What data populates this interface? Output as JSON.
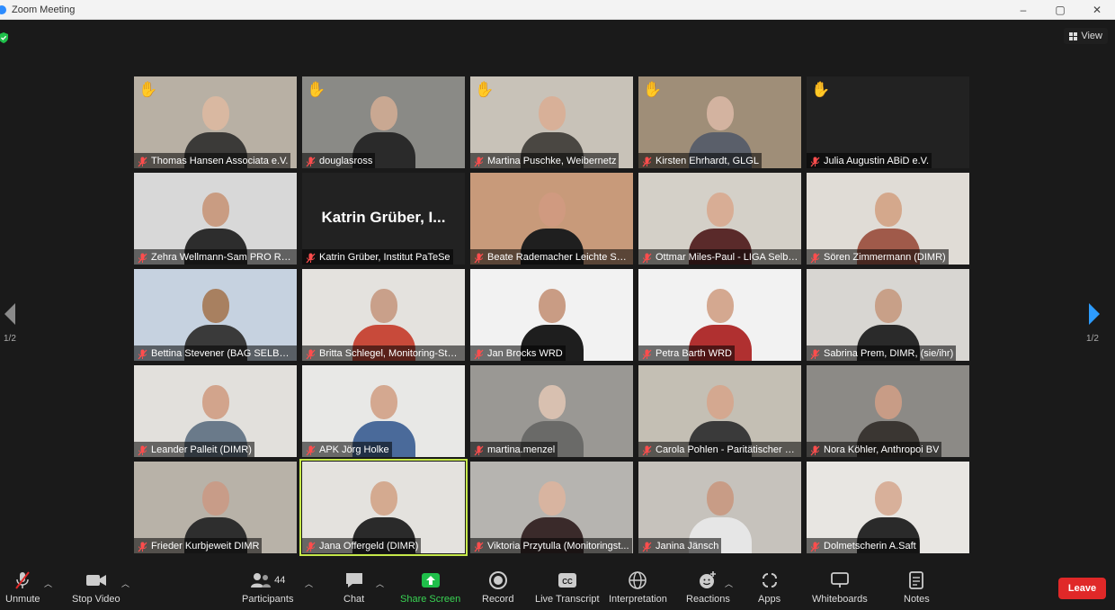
{
  "window": {
    "title": "Zoom Meeting",
    "controls": [
      "–",
      "▢",
      "✕"
    ]
  },
  "view_button": {
    "label": "View"
  },
  "pagination": {
    "left_label": "1/2",
    "right_label": "1/2"
  },
  "participants": [
    {
      "name": "Thomas Hansen Associata e.V.",
      "hand_raised": true,
      "bg": "#b8b0a4",
      "head": "#d9b8a1",
      "body": "#3b3a38"
    },
    {
      "name": "douglasross",
      "hand_raised": true,
      "bg": "#8a8a86",
      "head": "#c9a892",
      "body": "#2a2a2a"
    },
    {
      "name": "Martina Puschke, Weibernetz",
      "hand_raised": true,
      "bg": "#c8c2b8",
      "head": "#d8b098",
      "body": "#4a4742"
    },
    {
      "name": "Kirsten Ehrhardt, GLGL",
      "hand_raised": true,
      "bg": "#9f8e78",
      "head": "#d3b3a0",
      "body": "#5a5f6a"
    },
    {
      "name": "Julia Augustin ABiD e.V.",
      "hand_raised": true,
      "bg": "#222222",
      "head": "",
      "body": "",
      "no_video": true
    },
    {
      "name": "Zehra Wellmann-Sam PRO RET...",
      "hand_raised": false,
      "bg": "#d8d8d8",
      "head": "#c99c82",
      "body": "#2d2d2d"
    },
    {
      "name": "Katrin Grüber, Institut PaTeSe",
      "hand_raised": false,
      "bg": "#222222",
      "head": "",
      "body": "",
      "no_video": true,
      "big_label": "Katrin Grüber, I..."
    },
    {
      "name": "Beate Rademacher Leichte Sprache",
      "hand_raised": false,
      "bg": "#c89a7a",
      "head": "#d09a80",
      "body": "#1f1f1f"
    },
    {
      "name": "Ottmar Miles-Paul - LIGA Selbst...",
      "hand_raised": false,
      "bg": "#d4d0c8",
      "head": "#d8ad95",
      "body": "#5a2a2a"
    },
    {
      "name": "Sören Zimmermann (DIMR)",
      "hand_raised": false,
      "bg": "#e0dcd6",
      "head": "#d4a88c",
      "body": "#a05a4a"
    },
    {
      "name": "Bettina Stevener (BAG SELBSTH...",
      "hand_raised": false,
      "bg": "#c6d2e0",
      "head": "#a88060",
      "body": "#3a3a3a"
    },
    {
      "name": "Britta Schlegel, Monitoring-Stell...",
      "hand_raised": false,
      "bg": "#e4e2de",
      "head": "#c9a08a",
      "body": "#c84a3a"
    },
    {
      "name": "Jan Brocks WRD",
      "hand_raised": false,
      "bg": "#f2f2f2",
      "head": "#c99c84",
      "body": "#1e1e1e"
    },
    {
      "name": "Petra Barth WRD",
      "hand_raised": false,
      "bg": "#f2f2f2",
      "head": "#d4a890",
      "body": "#b03030"
    },
    {
      "name": "Sabrina Prem, DIMR, (sie/ihr)",
      "hand_raised": false,
      "bg": "#d8d6d2",
      "head": "#c8a088",
      "body": "#2a2a2a"
    },
    {
      "name": "Leander Palleit (DIMR)",
      "hand_raised": false,
      "bg": "#e2e0dc",
      "head": "#d2a48c",
      "body": "#6a7a8a"
    },
    {
      "name": "APK Jörg Holke",
      "hand_raised": false,
      "bg": "#e8e8e6",
      "head": "#d4a890",
      "body": "#4a6a9a"
    },
    {
      "name": "martina.menzel",
      "hand_raised": false,
      "bg": "#9a9894",
      "head": "#d8c0b0",
      "body": "#6a6a68"
    },
    {
      "name": "Carola Pohlen - Paritätischer GV",
      "hand_raised": false,
      "bg": "#c4bfb4",
      "head": "#d4a890",
      "body": "#3a3a3a"
    },
    {
      "name": "Nora Köhler, Anthropoi BV",
      "hand_raised": false,
      "bg": "#8c8a86",
      "head": "#c89c86",
      "body": "#3a3632"
    },
    {
      "name": "Frieder Kurbjeweit DIMR",
      "hand_raised": false,
      "bg": "#b8b2a8",
      "head": "#c89c88",
      "body": "#2e2e2e"
    },
    {
      "name": "Jana Offergeld (DIMR)",
      "hand_raised": false,
      "bg": "#e4e2de",
      "head": "#d4aa90",
      "body": "#2a2a2a",
      "active": true
    },
    {
      "name": "Viktoria Przytulla (Monitoringst...",
      "hand_raised": false,
      "bg": "#b6b4b0",
      "head": "#d8b4a0",
      "body": "#3a2a2a"
    },
    {
      "name": "Janina Jänsch",
      "hand_raised": false,
      "bg": "#c6c2bc",
      "head": "#c89c86",
      "body": "#e6e6e6"
    },
    {
      "name": "Dolmetscherin A.Saft",
      "hand_raised": false,
      "bg": "#e8e6e2",
      "head": "#d8b09a",
      "body": "#2a2a2a"
    }
  ],
  "toolbar": {
    "unmute": "Unmute",
    "stop_video": "Stop Video",
    "participants": "Participants",
    "participants_count": "44",
    "chat": "Chat",
    "share_screen": "Share Screen",
    "record": "Record",
    "live_transcript": "Live Transcript",
    "interpretation": "Interpretation",
    "reactions": "Reactions",
    "apps": "Apps",
    "whiteboards": "Whiteboards",
    "notes": "Notes",
    "leave": "Leave"
  },
  "colors": {
    "accent_green": "#39d353",
    "leave_red": "#e02828",
    "active_speaker": "#c6e84a",
    "nav_blue": "#2d9cff"
  }
}
